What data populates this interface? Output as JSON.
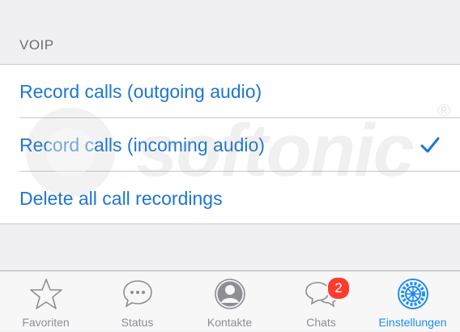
{
  "section": {
    "title": "VOIP"
  },
  "options": [
    {
      "label": "Record calls (outgoing audio)",
      "checked": false
    },
    {
      "label": "Record calls (incoming audio)",
      "checked": true
    },
    {
      "label": "Delete all call recordings",
      "checked": false
    }
  ],
  "watermark": {
    "text": "softonic",
    "mark": "®"
  },
  "tabbar": {
    "tabs": [
      {
        "label": "Favoriten",
        "icon": "star-icon",
        "active": false
      },
      {
        "label": "Status",
        "icon": "speech-bubble-dots-icon",
        "active": false
      },
      {
        "label": "Kontakte",
        "icon": "contact-silhouette-icon",
        "active": false
      },
      {
        "label": "Chats",
        "icon": "chat-bubbles-icon",
        "active": false,
        "badge": "2"
      },
      {
        "label": "Einstellungen",
        "icon": "gear-icon",
        "active": true
      }
    ]
  },
  "colors": {
    "accent": "#1d76d2",
    "tab_active": "#1d8ef0",
    "badge": "#ff3b30",
    "background": "#efeff4"
  }
}
